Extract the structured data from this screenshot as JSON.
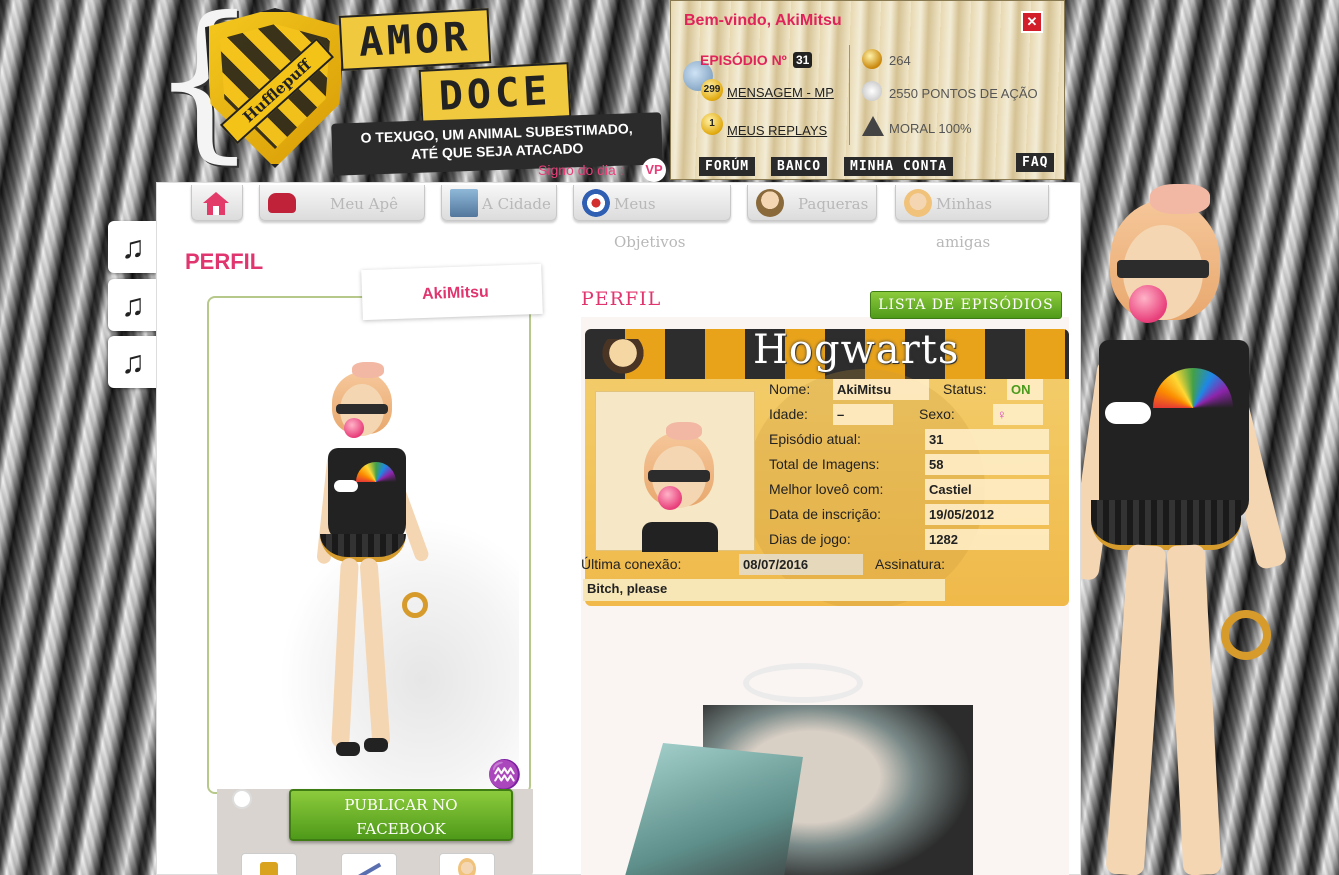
{
  "header": {
    "crest_label": "Hufflepuff",
    "logo_line1": "AMOR",
    "logo_line2": "DOCE",
    "tagline": "O TEXUGO, UM ANIMAL SUBESTIMADO,\nATÉ QUE SEJA ATACADO",
    "signo_text": "Signo do dia :",
    "signo_icon": "VP"
  },
  "welcome": {
    "title": "Bem-vindo, AkiMitsu",
    "close_label": "✕",
    "episode_label": "EPISÓDIO Nº",
    "episode_number": "31",
    "messages_badge": "299",
    "messages_link": "MENSAGEM - MP",
    "replays_badge": "1",
    "replays_link": "MEUS REPLAYS",
    "coins": "264",
    "action_points": "2550 PONTOS DE AÇÃO",
    "morale": "MORAL 100%",
    "nav": {
      "forum": "FORÚM",
      "banco": "BANCO",
      "minha_conta": "MINHA CONTA",
      "faq": "FAQ"
    }
  },
  "topnav": {
    "home_icon": "home-icon",
    "items": [
      {
        "label": "Meu Apê",
        "icon": "sofa-icon"
      },
      {
        "label": "A Cidade",
        "icon": "city-icon"
      },
      {
        "label": "Meus Objetivos",
        "icon": "target-icon"
      },
      {
        "label": "Paqueras",
        "icon": "boy-avatar-icon"
      },
      {
        "label": "Minhas amigas",
        "icon": "girl-avatar-icon"
      }
    ]
  },
  "side_buttons": [
    "♫",
    "♫",
    "♫"
  ],
  "page_title": "PERFIL",
  "profile_card": {
    "username": "AkiMitsu",
    "zodiac_glyph": "♒",
    "publish_button": "PUBLICAR NO\nFACEBOOK"
  },
  "profile": {
    "section_title": "PERFIL",
    "episodes_button": "LISTA DE EPISÓDIOS",
    "board_title": "Hogwarts",
    "fields": {
      "name_label": "Nome:",
      "name_value": "AkiMitsu",
      "status_label": "Status:",
      "status_value": "ON",
      "age_label": "Idade:",
      "age_value": "–",
      "sex_label": "Sexo:",
      "sex_value": "♀",
      "episode_label": "Episódio atual:",
      "episode_value": "31",
      "images_label": "Total de Imagens:",
      "images_value": "58",
      "lovebest_label": "Melhor loveô com:",
      "lovebest_value": "Castiel",
      "signup_label": "Data de inscrição:",
      "signup_value": "19/05/2012",
      "days_label": "Dias de jogo:",
      "days_value": "1282",
      "lastconn_label": "Última conexão:",
      "lastconn_value": "08/07/2016",
      "signature_label": "Assinatura:",
      "signature_value": "Bitch, please"
    }
  },
  "colors": {
    "accent_pink": "#e0356f",
    "button_green": "#6bb52a",
    "close_red": "#d21d2b"
  }
}
